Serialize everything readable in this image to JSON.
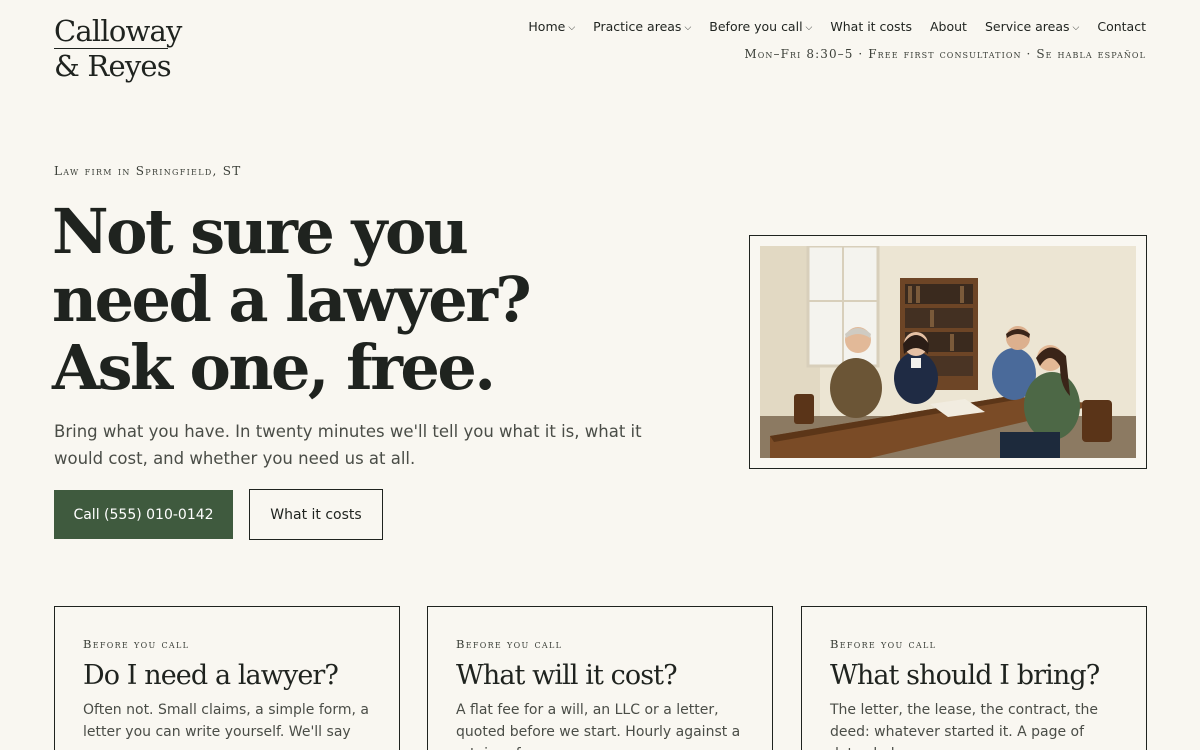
{
  "brand": {
    "line1": "Calloway",
    "line2": "& Reyes"
  },
  "nav": {
    "items": [
      {
        "label": "Home",
        "has_dropdown": true
      },
      {
        "label": "Practice areas",
        "has_dropdown": true
      },
      {
        "label": "Before you call",
        "has_dropdown": true
      },
      {
        "label": "What it costs",
        "has_dropdown": false
      },
      {
        "label": "About",
        "has_dropdown": false
      },
      {
        "label": "Service areas",
        "has_dropdown": true
      },
      {
        "label": "Contact",
        "has_dropdown": false
      }
    ],
    "chevron_glyph": "⌵"
  },
  "hours_line": "Mon–Fri 8:30–5 · Free first consultation · Se habla español",
  "hero": {
    "eyebrow": "Law firm in Springfield, ST",
    "title_lines": [
      "Not sure you",
      "need a lawyer?",
      "Ask one, free."
    ],
    "subtitle": "Bring what you have. In twenty minutes we'll tell you what it is, what it would cost, and whether you need us at all.",
    "primary_button": "Call (555) 010-0142",
    "secondary_button": "What it costs"
  },
  "cards": [
    {
      "eyebrow": "Before you call",
      "title": "Do I need a lawyer?",
      "body": "Often not. Small claims, a simple form, a letter you can write yourself. We'll say so,"
    },
    {
      "eyebrow": "Before you call",
      "title": "What will it cost?",
      "body": "A flat fee for a will, an LLC or a letter, quoted before we start. Hourly against a retainer for"
    },
    {
      "eyebrow": "Before you call",
      "title": "What should I bring?",
      "body": "The letter, the lease, the contract, the deed: whatever started it. A page of dates helps."
    }
  ],
  "colors": {
    "background": "#f9f7f1",
    "ink": "#1f231f",
    "accent_green": "#3f5a3e",
    "muted_text": "#4a4d47"
  }
}
